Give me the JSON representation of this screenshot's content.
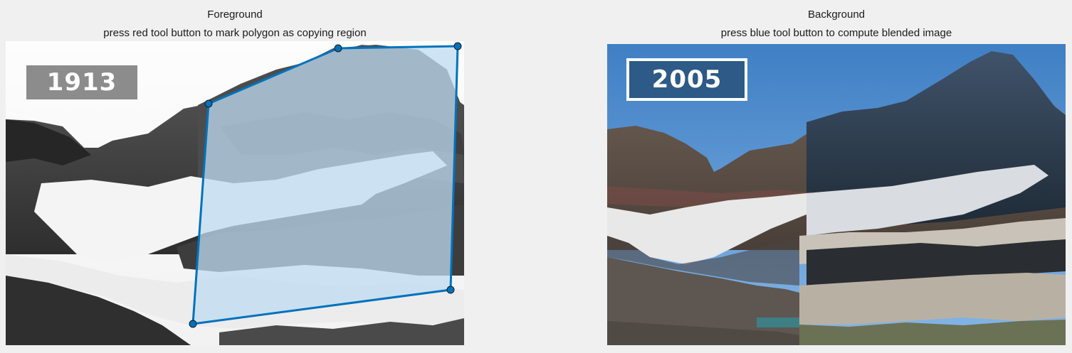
{
  "foreground": {
    "title": "Foreground",
    "instruction": "press red tool button to mark polygon as copying region",
    "year_label": "1913"
  },
  "background": {
    "title": "Background",
    "instruction": "press blue tool button to compute blended image",
    "year_label": "2005"
  },
  "colors": {
    "figure_bg": "#f0f0f0",
    "polygon_stroke": "#0072bd",
    "polygon_fill": "#bfdcf2",
    "vertex_fill": "#0072bd"
  }
}
